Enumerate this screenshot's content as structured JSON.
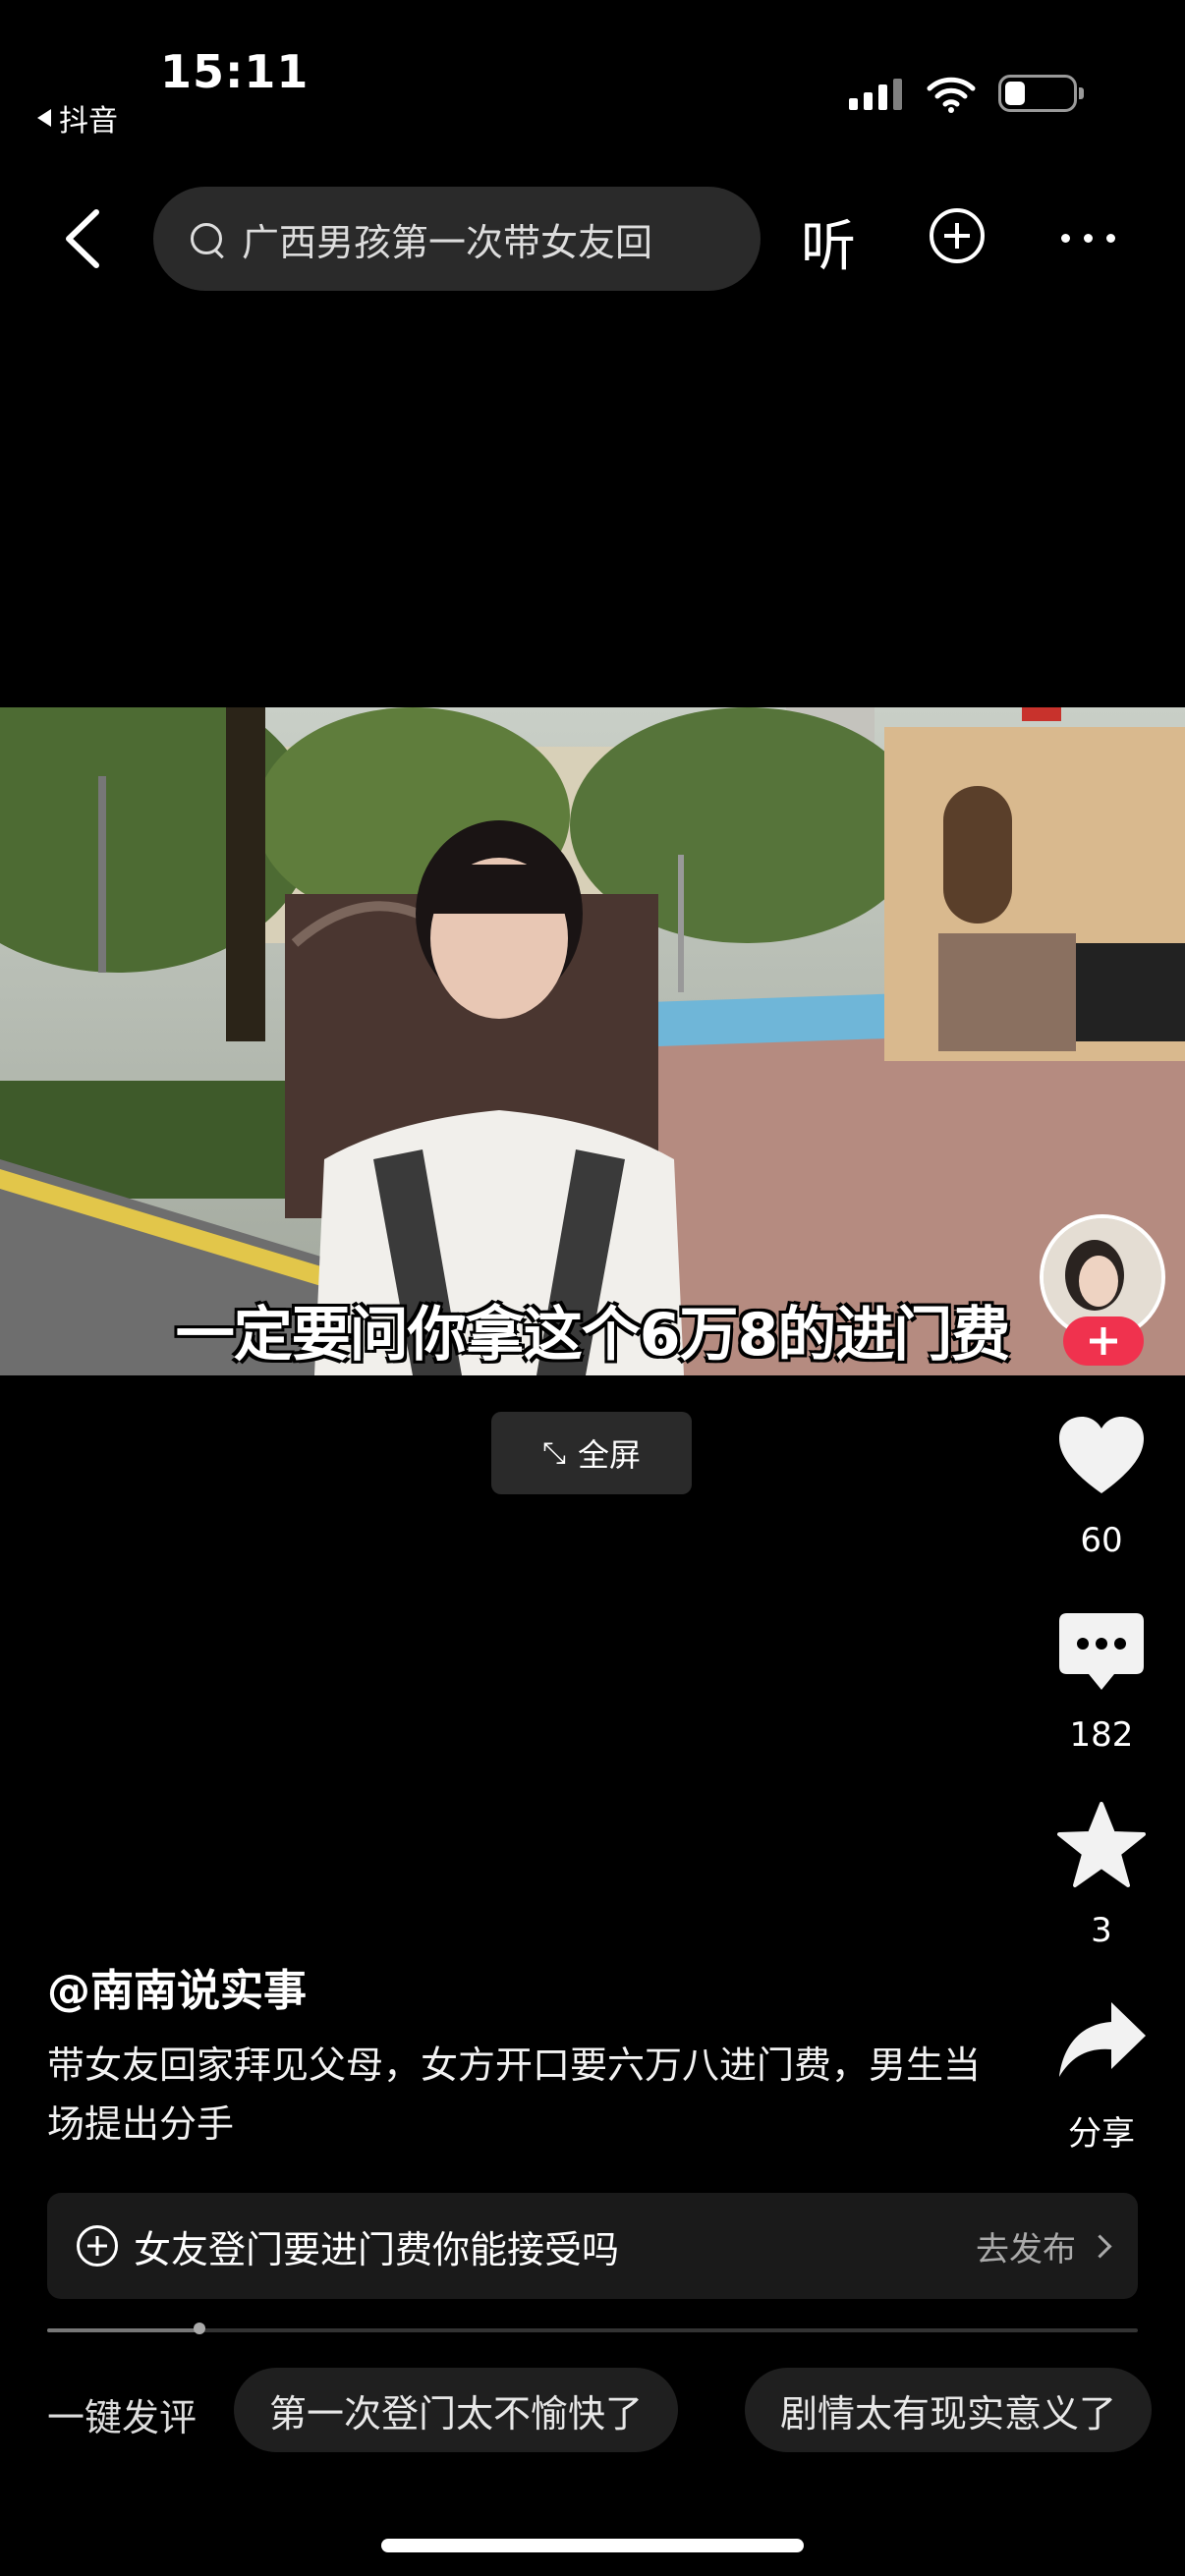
{
  "status_bar": {
    "time": "15:11",
    "back_app": "抖音"
  },
  "nav": {
    "search_query": "广西男孩第一次带女友回",
    "listen_label": "听"
  },
  "video": {
    "subtitle": "一定要问你拿这个6万8的进门费",
    "fullscreen_label": "全屏"
  },
  "actions": {
    "like_count": "60",
    "comment_count": "182",
    "favorite_count": "3",
    "share_label": "分享"
  },
  "post": {
    "author": "@南南说实事",
    "description": "带女友回家拜见父母，女方开口要六万八进门费，男生当场提出分手"
  },
  "topic": {
    "text": "女友登门要进门费你能接受吗",
    "action": "去发布"
  },
  "playback": {
    "progress": 0.14
  },
  "quick_comments": {
    "label": "一键发评",
    "chips": [
      "第一次登门太不愉快了",
      "剧情太有现实意义了"
    ]
  },
  "colors": {
    "follow_accent": "#f0324e",
    "background": "#000000"
  }
}
